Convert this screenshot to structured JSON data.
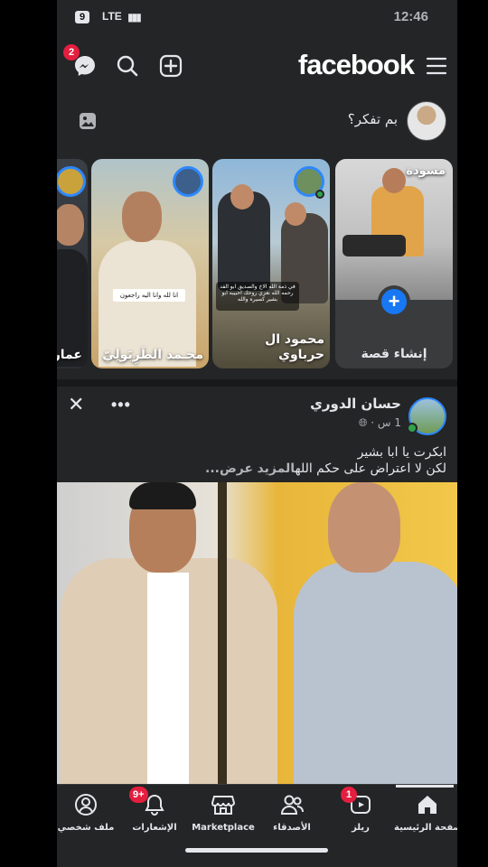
{
  "status_bar": {
    "battery": "9",
    "network": "LTE",
    "time": "12:46"
  },
  "header": {
    "logo": "facebook",
    "messenger_badge": "2"
  },
  "composer": {
    "prompt": "بم تفكر؟"
  },
  "stories": {
    "create_label": "إنشاء قصة",
    "draft_label": "مسودة",
    "items": [
      {
        "name": "محمود ال حرباوي"
      },
      {
        "name": "محـمد الطَرِبَولِيّ"
      },
      {
        "name": "عمار"
      }
    ],
    "overlay_texts": [
      "انا لله وانا اليه راجعون",
      "في ذمة الله الاخ والصديق ابو الفد رحمه الله نعزي روحك احبيبه ابو بشير كسيره والله"
    ]
  },
  "post": {
    "author": "حسان الدوري",
    "meta": "1 س ·",
    "text_line1": "ابكرت يا ابا بشير",
    "text_line2": "لكن لا اعتراض على حكم الله",
    "more_label": "المزيد",
    "more_trail": "عرض..."
  },
  "bottom_nav": {
    "items": [
      {
        "label": "الصفحة الرئيسية",
        "icon": "home-icon",
        "active": true
      },
      {
        "label": "ريلز",
        "icon": "reels-icon",
        "badge": "1"
      },
      {
        "label": "الأصدقاء",
        "icon": "friends-icon"
      },
      {
        "label": "Marketplace",
        "icon": "marketplace-icon"
      },
      {
        "label": "الإشعارات",
        "icon": "bell-icon",
        "badge": "9+"
      },
      {
        "label": "ملف شخصي",
        "icon": "profile-icon"
      }
    ]
  },
  "colors": {
    "background": "#242526",
    "accent": "#1877f2",
    "badge": "#e41e3f",
    "online": "#31a24c"
  }
}
